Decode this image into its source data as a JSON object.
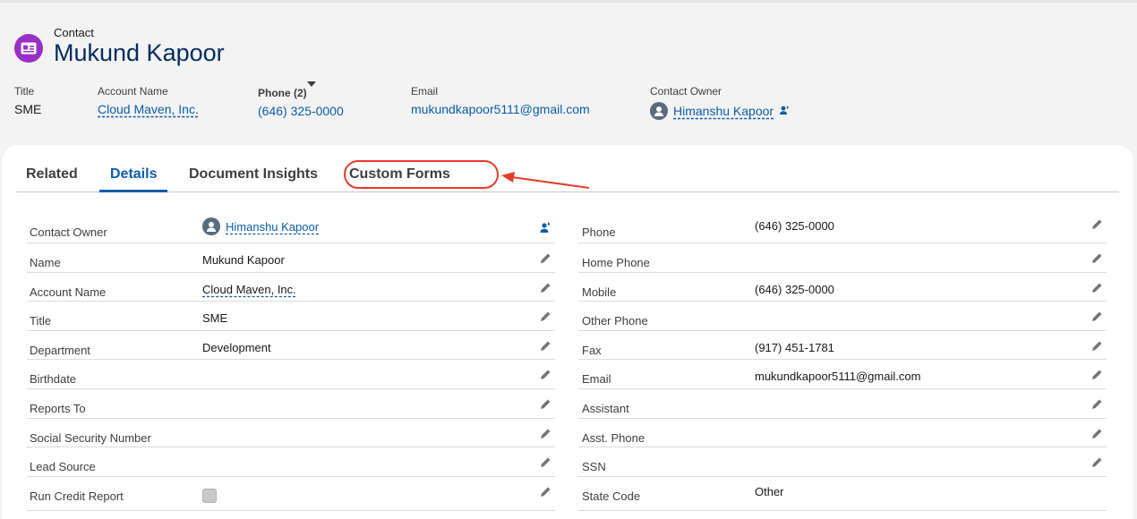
{
  "header": {
    "object_type": "Contact",
    "record_name": "Mukund Kapoor",
    "icon": "contact-card-icon",
    "icon_color": "#9a2fc5"
  },
  "highlights": {
    "title_label": "Title",
    "title_value": "SME",
    "account_label": "Account Name",
    "account_value": "Cloud Maven, Inc.",
    "phone_label": "Phone (2)",
    "phone_value": "(646) 325-0000",
    "email_label": "Email",
    "email_value": "mukundkapoor5111@gmail.com",
    "owner_label": "Contact Owner",
    "owner_value": "Himanshu Kapoor"
  },
  "tabs": [
    {
      "label": "Related"
    },
    {
      "label": "Details",
      "active": true
    },
    {
      "label": "Document Insights"
    },
    {
      "label": "Custom Forms",
      "highlighted": true
    }
  ],
  "details_left": [
    {
      "label": "Contact Owner",
      "value": "Himanshu Kapoor"
    },
    {
      "label": "Name",
      "value": "Mukund Kapoor"
    },
    {
      "label": "Account Name",
      "value": "Cloud Maven, Inc."
    },
    {
      "label": "Title",
      "value": "SME"
    },
    {
      "label": "Department",
      "value": "Development"
    },
    {
      "label": "Birthdate",
      "value": ""
    },
    {
      "label": "Reports To",
      "value": ""
    },
    {
      "label": "Social Security Number",
      "value": ""
    },
    {
      "label": "Lead Source",
      "value": ""
    },
    {
      "label": "Run Credit Report",
      "value": ""
    }
  ],
  "details_right": [
    {
      "label": "Phone",
      "value": "(646) 325-0000"
    },
    {
      "label": "Home Phone",
      "value": ""
    },
    {
      "label": "Mobile",
      "value": "(646) 325-0000"
    },
    {
      "label": "Other Phone",
      "value": ""
    },
    {
      "label": "Fax",
      "value": "(917) 451-1781"
    },
    {
      "label": "Email",
      "value": "mukundkapoor5111@gmail.com"
    },
    {
      "label": "Assistant",
      "value": ""
    },
    {
      "label": "Asst. Phone",
      "value": ""
    },
    {
      "label": "SSN",
      "value": ""
    },
    {
      "label": "State Code",
      "value": "Other"
    }
  ],
  "colors": {
    "link": "#0b5cab",
    "record_name": "#032d60",
    "annotation": "#e53b2c"
  }
}
